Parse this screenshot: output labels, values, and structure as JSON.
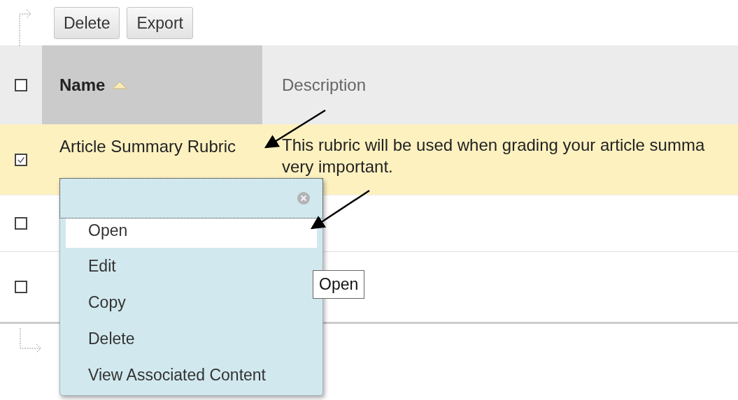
{
  "toolbar": {
    "buttons": [
      "Delete",
      "Export"
    ]
  },
  "table": {
    "select_all": {
      "checked": false
    },
    "columns": [
      {
        "label": "Name",
        "sorted": true
      },
      {
        "label": "Description",
        "sorted": false
      }
    ],
    "rows": [
      {
        "checked": true,
        "name": "Article Summary Rubric",
        "description_lines": [
          "This rubric will be used when grading your article summa",
          "very important."
        ]
      },
      {
        "checked": false
      },
      {
        "checked": false
      }
    ]
  },
  "context_menu": {
    "items": [
      {
        "label": "Open",
        "selected": true
      },
      {
        "label": "Edit",
        "selected": false
      },
      {
        "label": "Copy",
        "selected": false
      },
      {
        "label": "Delete",
        "selected": false
      },
      {
        "label": "View Associated Content",
        "selected": false
      }
    ]
  },
  "tooltip": "Open"
}
